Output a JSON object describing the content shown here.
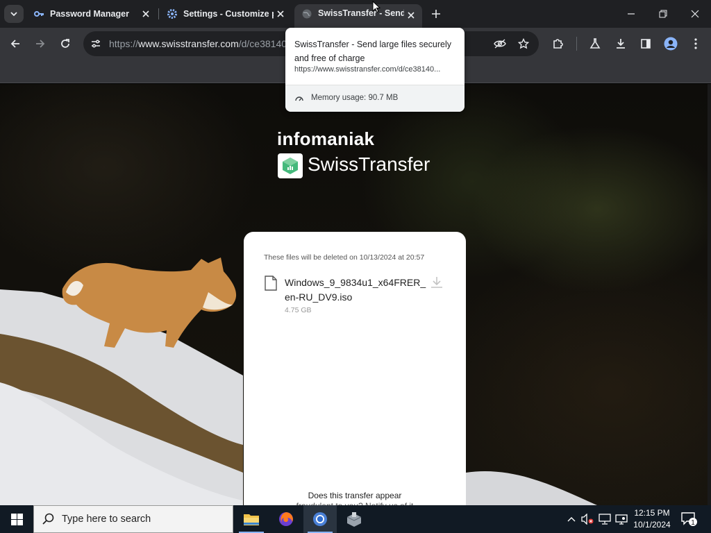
{
  "browser": {
    "tabs": [
      {
        "title": "Password Manager",
        "icon": "key-icon"
      },
      {
        "title": "Settings - Customize profile",
        "icon": "gear-icon"
      },
      {
        "title": "SwissTransfer - Send large files securely and free of charge",
        "icon": "globe-icon",
        "active": true
      }
    ],
    "url_prefix": "https://",
    "url_host": "www.swisstransfer.com",
    "url_path": "/d/ce38140",
    "accent": "#8ab4f8"
  },
  "hover_card": {
    "title": "SwissTransfer - Send large files securely and free of charge",
    "url": "https://www.swisstransfer.com/d/ce38140...",
    "memory": "Memory usage: 90.7 MB"
  },
  "page": {
    "brand_top": "infomaniak",
    "brand_name": "SwissTransfer",
    "notice": "These files will be deleted on 10/13/2024 at 20:57",
    "file": {
      "name": "Windows_9_9834u1_x64FRER_en-RU_DV9.iso",
      "size": "4.75 GB"
    },
    "footer_line1": "Does this transfer appear",
    "footer_line2": "fraudulent to you? Notify us of it"
  },
  "taskbar": {
    "search_placeholder": "Type here to search",
    "time": "12:15 PM",
    "date": "10/1/2024",
    "notification_count": "1"
  }
}
